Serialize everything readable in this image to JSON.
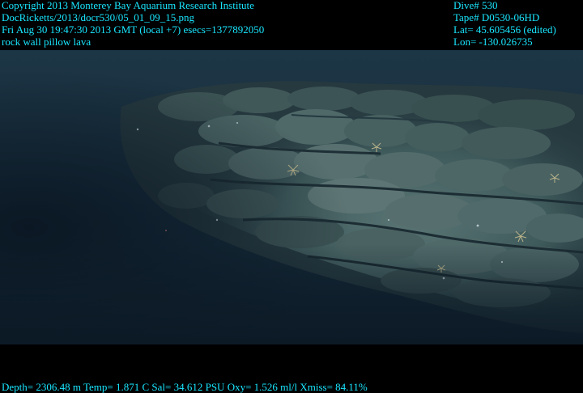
{
  "header_left": {
    "copyright": "Copyright 2013 Monterey Bay Aquarium Research Institute",
    "file_path": "DocRicketts/2013/docr530/05_01_09_15.png",
    "datetime": "Fri Aug 30 19:47:30 2013 GMT (local +7)  esecs=1377892050",
    "description": "rock wall pillow lava"
  },
  "header_right": {
    "dive": "Dive# 530",
    "tape": "Tape# D0530-06HD",
    "lat": "Lat= 45.605456 (edited)",
    "lon": "Lon= -130.026735"
  },
  "footer": {
    "telemetry": "Depth= 2306.48 m  Temp= 1.871 C  Sal= 34.612 PSU  Oxy= 1.526 ml/l  Xmiss= 84.11%"
  },
  "colors": {
    "overlay_text": "#19e6ff",
    "background": "#000000",
    "water_deep": "#0d1c2a",
    "water_mid": "#1c3442",
    "rock_light": "#4e6a6e",
    "rock_mid": "#36504f",
    "rock_shadow": "#1a2b30"
  }
}
